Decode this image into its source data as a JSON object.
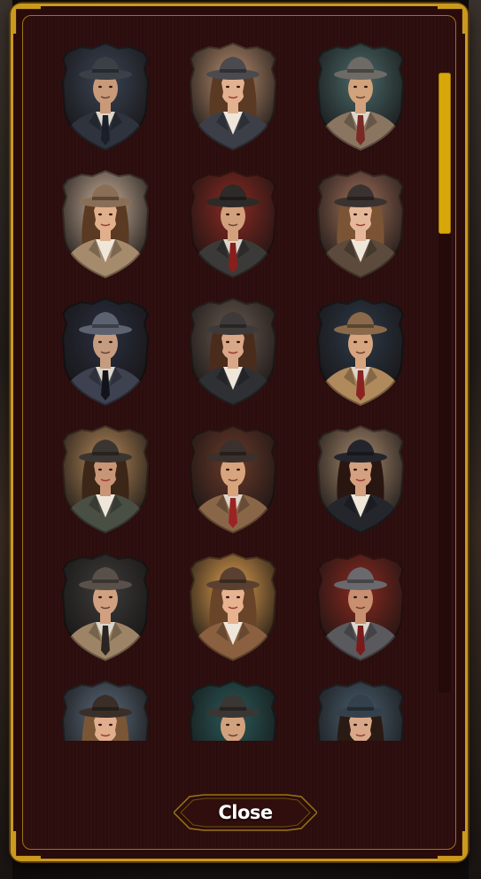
{
  "dialog": {
    "close_label": "Close"
  },
  "colors": {
    "frame_gold": "#c99a1e",
    "panel_maroon": "#2b0d0c",
    "scroll_thumb": "#d8a70a"
  },
  "scroll": {
    "position_fraction": 0.0,
    "visible_fraction": 0.26
  },
  "avatars": [
    {
      "name": "detective-man-1",
      "gender": "male",
      "coat": "#2e333d",
      "hat": "#3b3f46",
      "bg": "#3a4454",
      "tie": "#1a1f2a",
      "hair": "#1b1310",
      "skin": "#c99a7a"
    },
    {
      "name": "detective-woman-1",
      "gender": "female",
      "coat": "#3d3f48",
      "hat": "#4a4a4f",
      "bg": "#b98f70",
      "tie": "#f1ede6",
      "hair": "#5b3a24",
      "skin": "#e2b290"
    },
    {
      "name": "detective-man-2",
      "gender": "male",
      "coat": "#8a7560",
      "hat": "#6e6a66",
      "bg": "#4b6a6a",
      "tie": "#7a2a24",
      "hair": "#2a1c14",
      "skin": "#d2a27c"
    },
    {
      "name": "detective-woman-2",
      "gender": "female",
      "coat": "#a58a6c",
      "hat": "#8a6e55",
      "bg": "#c9b09a",
      "tie": "#e8dccd",
      "hair": "#5a3a22",
      "skin": "#e0b08c"
    },
    {
      "name": "detective-man-3",
      "gender": "male",
      "coat": "#3c3a38",
      "hat": "#2d2a28",
      "bg": "#8a2a22",
      "tie": "#8a1e1c",
      "hair": "#1f1612",
      "skin": "#d2a07c"
    },
    {
      "name": "detective-woman-3",
      "gender": "female",
      "coat": "#5c4b3c",
      "hat": "#3a3230",
      "bg": "#a0705a",
      "tie": "#efe4d6",
      "hair": "#7a5434",
      "skin": "#e6b89a"
    },
    {
      "name": "detective-man-4",
      "gender": "male",
      "coat": "#3e4250",
      "hat": "#5d6270",
      "bg": "#2a3040",
      "tie": "#121419",
      "hair": "#1a1512",
      "skin": "#c69c80"
    },
    {
      "name": "detective-woman-4",
      "gender": "female",
      "coat": "#2f3034",
      "hat": "#3e3a3a",
      "bg": "#6a5a50",
      "tie": "#f0ece6",
      "hair": "#4a2c1c",
      "skin": "#d8a888"
    },
    {
      "name": "detective-man-5",
      "gender": "male",
      "coat": "#b08a5c",
      "hat": "#8a6a4a",
      "bg": "#2e3a48",
      "tie": "#8a2222",
      "hair": "#2a1e16",
      "skin": "#d6a47e"
    },
    {
      "name": "detective-woman-5",
      "gender": "female",
      "coat": "#4a4f44",
      "hat": "#3a3530",
      "bg": "#b68a5a",
      "tie": "#6a5a40",
      "hair": "#3c2618",
      "skin": "#c89676"
    },
    {
      "name": "detective-man-6",
      "gender": "male",
      "coat": "#8a6648",
      "hat": "#3a302c",
      "bg": "#6a3a2a",
      "tie": "#9a2424",
      "hair": "#2a1a12",
      "skin": "#d8a47e"
    },
    {
      "name": "detective-woman-6",
      "gender": "female",
      "coat": "#24262c",
      "hat": "#23252c",
      "bg": "#a88a6e",
      "tie": "#dcd6cc",
      "hair": "#2a1610",
      "skin": "#d4a080"
    },
    {
      "name": "detective-man-7",
      "gender": "male",
      "coat": "#9e8466",
      "hat": "#5a504a",
      "bg": "#3c3c3a",
      "tie": "#2a2522",
      "hair": "#2a1e18",
      "skin": "#d0a080"
    },
    {
      "name": "detective-woman-7",
      "gender": "female",
      "coat": "#8a6040",
      "hat": "#5a4030",
      "bg": "#e0a050",
      "tie": "#6a4a30",
      "hair": "#6a4428",
      "skin": "#e6b290"
    },
    {
      "name": "detective-man-8",
      "gender": "male",
      "coat": "#5a5a5e",
      "hat": "#6a6a6e",
      "bg": "#8a2a20",
      "tie": "#7a1a1a",
      "hair": "#2a1c14",
      "skin": "#c89070"
    },
    {
      "name": "detective-woman-8",
      "gender": "female",
      "coat": "#6a4e3a",
      "hat": "#3a2e28",
      "bg": "#5a6a7a",
      "tie": "#e6dccf",
      "hair": "#7a5636",
      "skin": "#e0ae8c"
    },
    {
      "name": "detective-man-9",
      "gender": "male",
      "coat": "#3a3634",
      "hat": "#3a3634",
      "bg": "#2a5a5a",
      "tie": "#7a2a24",
      "hair": "#2a1c14",
      "skin": "#d2a27e"
    },
    {
      "name": "detective-woman-9",
      "gender": "female",
      "coat": "#2e3640",
      "hat": "#34404c",
      "bg": "#4a6070",
      "tie": "#e8e0d8",
      "hair": "#2a1a14",
      "skin": "#d8a888"
    }
  ]
}
